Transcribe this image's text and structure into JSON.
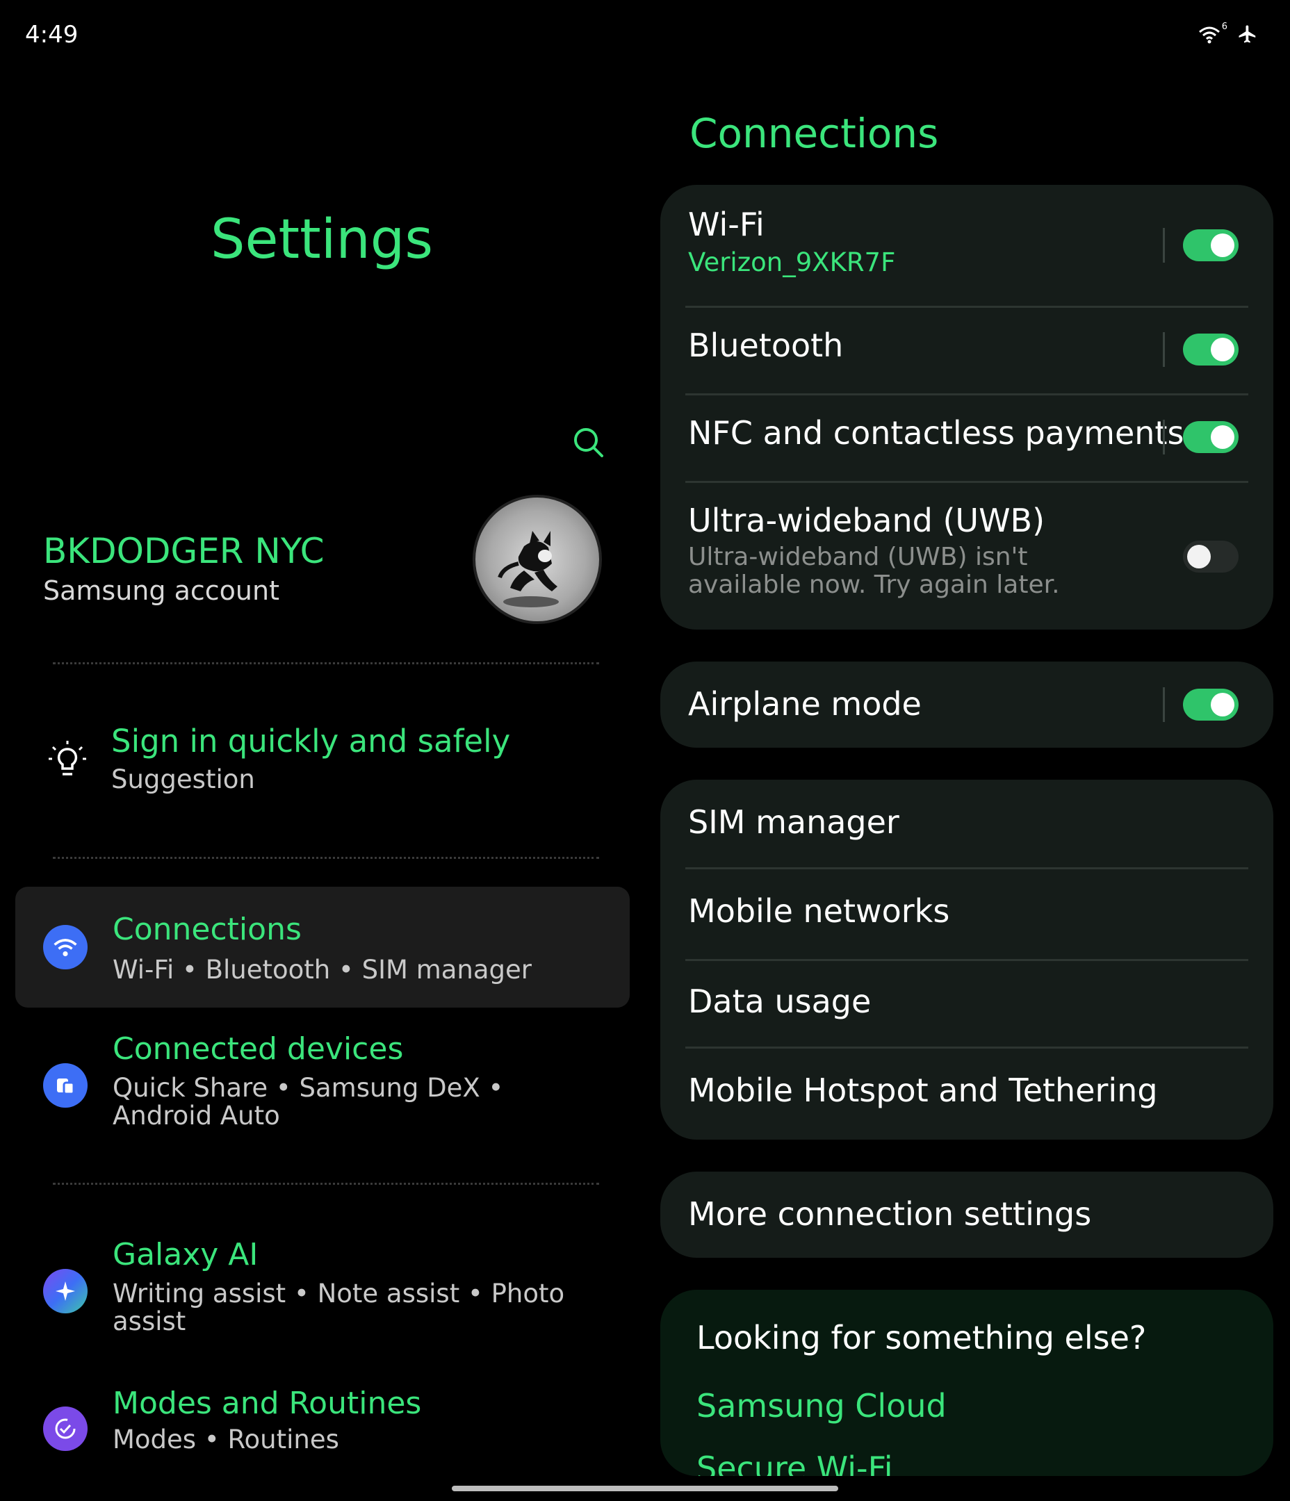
{
  "status_bar": {
    "time": "4:49",
    "wifi_badge": "6"
  },
  "left": {
    "title": "Settings",
    "account": {
      "name": "BKDODGER NYC",
      "subtitle": "Samsung account"
    },
    "suggestion": {
      "title": "Sign in quickly and safely",
      "subtitle": "Suggestion"
    },
    "items": [
      {
        "title": "Connections",
        "subtitle_parts": [
          "Wi-Fi",
          "Bluetooth",
          "SIM manager"
        ],
        "icon": "wifi-icon",
        "color": "#3d6ef5"
      },
      {
        "title": "Connected devices",
        "subtitle_parts": [
          "Quick Share",
          "Samsung DeX",
          "Android Auto"
        ],
        "icon": "connected-devices-icon",
        "color": "#3d6ef5"
      },
      {
        "title": "Galaxy AI",
        "subtitle_parts": [
          "Writing assist",
          "Note assist",
          "Photo assist"
        ],
        "icon": "sparkle-icon",
        "color": "#3d5ef0"
      },
      {
        "title": "Modes and Routines",
        "subtitle_parts": [
          "Modes",
          "Routines"
        ],
        "icon": "check-circle-icon",
        "color": "#7b4ae8"
      }
    ],
    "separator": " • "
  },
  "right": {
    "title": "Connections",
    "wifi": {
      "label": "Wi-Fi",
      "network": "Verizon_9XKR7F",
      "on": true
    },
    "bluetooth": {
      "label": "Bluetooth",
      "on": true
    },
    "nfc": {
      "label": "NFC and contactless payments",
      "on": true
    },
    "uwb": {
      "label": "Ultra-wideband (UWB)",
      "sub": "Ultra-wideband (UWB) isn't available now. Try again later.",
      "on": false
    },
    "airplane": {
      "label": "Airplane mode",
      "on": true
    },
    "sim_manager": "SIM manager",
    "mobile_networks": "Mobile networks",
    "data_usage": "Data usage",
    "hotspot": "Mobile Hotspot and Tethering",
    "more": "More connection settings",
    "looking": {
      "title": "Looking for something else?",
      "links": [
        "Samsung Cloud",
        "Secure Wi-Fi"
      ]
    }
  },
  "colors": {
    "accent": "#3be57c",
    "card": "#151c19",
    "toggle_on": "#2fc46a"
  }
}
